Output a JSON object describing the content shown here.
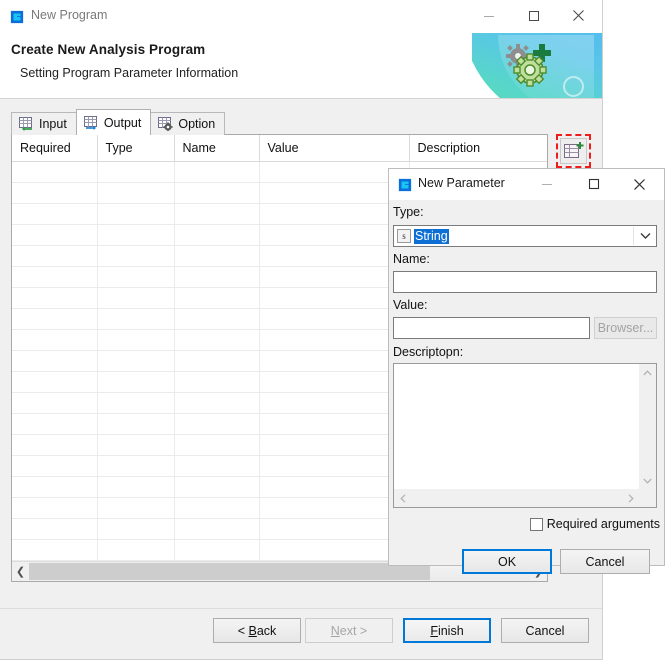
{
  "wizard_window": {
    "title": "New Program",
    "icon": "app-logo-icon",
    "controls": {
      "minimize": "minimize-icon",
      "maximize": "maximize-icon",
      "close": "close-icon"
    },
    "banner": {
      "heading": "Create New Analysis Program",
      "subheading": "Setting Program Parameter Information",
      "art": "gears-plus-graphic",
      "gradient_from": "#4fb8ef",
      "gradient_to": "#4fdcb9"
    },
    "tabs": [
      {
        "label": "Input",
        "icon": "table-in-icon",
        "active": false
      },
      {
        "label": "Output",
        "icon": "table-out-icon",
        "active": true
      },
      {
        "label": "Option",
        "icon": "table-gear-icon",
        "active": false
      }
    ],
    "table": {
      "columns": [
        "Required",
        "Type",
        "Name",
        "Value",
        "Description"
      ],
      "rows": [],
      "empty_row_count": 19,
      "hscroll": {
        "thumb_percent": 80,
        "left_arrow": "chevron-left-icon",
        "right_arrow": "chevron-right-icon"
      }
    },
    "add_row_button": {
      "icon": "add-row-icon",
      "annotation": "red-dashed-highlight",
      "annotation_color": "#ef1c1c"
    },
    "footer_buttons": [
      {
        "id": "back",
        "label": "< Back",
        "accel": "B",
        "enabled": true,
        "default": false
      },
      {
        "id": "next",
        "label": "Next >",
        "accel": "N",
        "enabled": false,
        "default": false
      },
      {
        "id": "finish",
        "label": "Finish",
        "accel": "F",
        "enabled": true,
        "default": true
      },
      {
        "id": "cancel",
        "label": "Cancel",
        "accel": "",
        "enabled": true,
        "default": false
      }
    ]
  },
  "dialog": {
    "title": "New Parameter",
    "icon": "app-logo-icon",
    "controls": {
      "minimize": "minimize-icon",
      "maximize": "maximize-icon",
      "close": "close-icon"
    },
    "fields": {
      "type_label": "Type:",
      "type_value": "String",
      "type_value_selected": true,
      "type_icon": "s",
      "type_caret": "chevron-down-icon",
      "name_label": "Name:",
      "name_value": "",
      "name_placeholder": "",
      "value_label": "Value:",
      "value_value": "",
      "value_placeholder": "",
      "browser_label": "Browser...",
      "browser_enabled": false,
      "description_label": "Descriptopn:",
      "description_value": "",
      "description_placeholder": ""
    },
    "checkbox": {
      "label": "Required arguments",
      "checked": false
    },
    "buttons": [
      {
        "id": "ok",
        "label": "OK",
        "default": true
      },
      {
        "id": "cancel",
        "label": "Cancel",
        "default": false
      }
    ],
    "accent_color": "#0078d7",
    "selection_color": "#0d6ed4"
  }
}
